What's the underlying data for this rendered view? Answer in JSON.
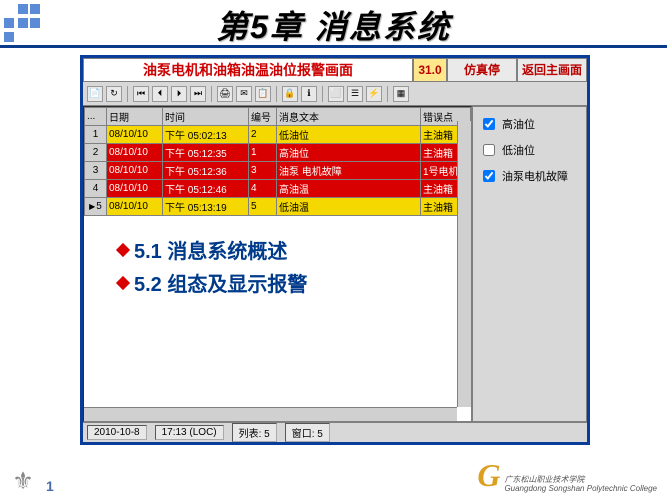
{
  "slide": {
    "title": "第5章  消息系统",
    "page_number": "1"
  },
  "app": {
    "header": {
      "title": "油泵电机和油箱油温油位报警画面",
      "value": "31.0",
      "sim_stop": "仿真停",
      "return_main": "返回主画面"
    },
    "grid": {
      "headers": {
        "rownum": "...",
        "date": "日期",
        "time": "时间",
        "no": "编号",
        "text": "消息文本",
        "point": "错误点"
      },
      "rows": [
        {
          "cls": "row-yellow",
          "n": "1",
          "date": "08/10/10",
          "time": "下午 05:02:13",
          "no": "2",
          "text": "低油位",
          "point": "主油箱"
        },
        {
          "cls": "row-red",
          "n": "2",
          "date": "08/10/10",
          "time": "下午 05:12:35",
          "no": "1",
          "text": "高油位",
          "point": "主油箱"
        },
        {
          "cls": "row-red",
          "n": "3",
          "date": "08/10/10",
          "time": "下午 05:12:36",
          "no": "3",
          "text": "油泵 电机故障",
          "point": "1号电机"
        },
        {
          "cls": "row-red",
          "n": "4",
          "date": "08/10/10",
          "time": "下午 05:12:46",
          "no": "4",
          "text": "高油温",
          "point": "主油箱"
        },
        {
          "cls": "row-yellow row-current",
          "n": "5",
          "date": "08/10/10",
          "time": "下午 05:13:19",
          "no": "5",
          "text": "低油温",
          "point": "主油箱"
        }
      ]
    },
    "side": {
      "opt1": {
        "label": "高油位",
        "checked": true
      },
      "opt2": {
        "label": "低油位",
        "checked": false
      },
      "opt3": {
        "label": "油泵电机故障",
        "checked": true
      }
    },
    "statusbar": {
      "date": "2010-10-8",
      "time": "17:13 (LOC)",
      "list": "列表: 5",
      "window": "窗口: 5"
    }
  },
  "overlay": {
    "line1": "5.1 消息系统概述",
    "line2": "5.2 组态及显示报警"
  },
  "footer": {
    "school_cn": "广东松山职业技术学院",
    "school_en": "Guangdong Songshan Polytechnic College"
  }
}
